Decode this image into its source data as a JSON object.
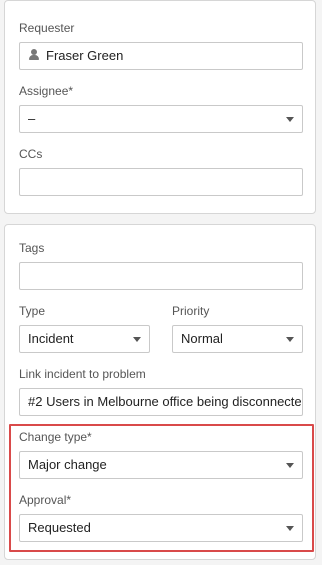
{
  "people": {
    "requester_label": "Requester",
    "requester_value": "Fraser Green",
    "assignee_label": "Assignee*",
    "assignee_value": "–",
    "ccs_label": "CCs",
    "ccs_value": ""
  },
  "properties": {
    "tags_label": "Tags",
    "tags_value": "",
    "type_label": "Type",
    "type_value": "Incident",
    "priority_label": "Priority",
    "priority_value": "Normal",
    "link_label": "Link incident to problem",
    "link_value": "#2 Users in Melbourne office being disconnecte",
    "change_type_label": "Change type*",
    "change_type_value": "Major change",
    "approval_label": "Approval*",
    "approval_value": "Requested"
  },
  "icons": {
    "requester": "person-icon",
    "dropdown": "chevron-down-icon"
  },
  "colors": {
    "highlight_border": "#d94a4a",
    "panel_background": "#ffffff",
    "page_background": "#f4f4f4"
  }
}
